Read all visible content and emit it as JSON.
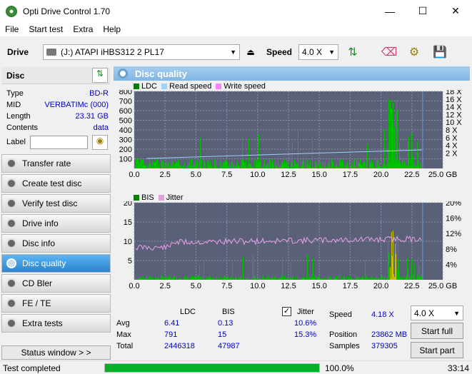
{
  "window": {
    "title": "Opti Drive Control 1.70"
  },
  "menu": [
    "File",
    "Start test",
    "Extra",
    "Help"
  ],
  "toolbar": {
    "drive_label": "Drive",
    "drive_value": "(J:)  ATAPI iHBS312  2 PL17",
    "speed_label": "Speed",
    "speed_value": "4.0 X"
  },
  "disc": {
    "header": "Disc",
    "type_label": "Type",
    "type": "BD-R",
    "mid_label": "MID",
    "mid": "VERBATIMc (000)",
    "length_label": "Length",
    "length": "23.31 GB",
    "contents_label": "Contents",
    "contents": "data",
    "label_label": "Label",
    "label_value": ""
  },
  "nav": [
    "Transfer rate",
    "Create test disc",
    "Verify test disc",
    "Drive info",
    "Disc info",
    "Disc quality",
    "CD Bler",
    "FE / TE",
    "Extra tests"
  ],
  "status_window_label": "Status window > >",
  "panel": {
    "title": "Disc quality"
  },
  "chart_data": [
    {
      "type": "bar",
      "title": "LDC / Read speed",
      "legend": [
        "LDC",
        "Read speed",
        "Write speed"
      ],
      "x_ticks": [
        "0.0",
        "2.5",
        "5.0",
        "7.5",
        "10.0",
        "12.5",
        "15.0",
        "17.5",
        "20.0",
        "22.5",
        "25.0 GB"
      ],
      "y_ticks_left": [
        "800",
        "700",
        "600",
        "500",
        "400",
        "300",
        "200",
        "100"
      ],
      "y_ticks_right": [
        "18 X",
        "16 X",
        "14 X",
        "12 X",
        "10 X",
        "8 X",
        "6 X",
        "4 X",
        "2 X"
      ],
      "xlim": [
        0,
        25
      ],
      "ylim": [
        0,
        800
      ],
      "read_speed_range_x": [
        1.0,
        4.18
      ]
    },
    {
      "type": "bar",
      "title": "BIS / Jitter",
      "legend": [
        "BIS",
        "Jitter"
      ],
      "x_ticks": [
        "0.0",
        "2.5",
        "5.0",
        "7.5",
        "10.0",
        "12.5",
        "15.0",
        "17.5",
        "20.0",
        "22.5",
        "25.0 GB"
      ],
      "y_ticks_left": [
        "20",
        "15",
        "10",
        "5"
      ],
      "y_ticks_right": [
        "20%",
        "16%",
        "12%",
        "8%",
        "4%"
      ],
      "xlim": [
        0,
        25
      ],
      "ylim": [
        0,
        20
      ]
    }
  ],
  "stats": {
    "col_ldc": "LDC",
    "col_bis": "BIS",
    "jitter_label": "Jitter",
    "jitter_checked": true,
    "rows": [
      {
        "label": "Avg",
        "ldc": "6.41",
        "bis": "0.13",
        "jitter": "10.6%"
      },
      {
        "label": "Max",
        "ldc": "791",
        "bis": "15",
        "jitter": "15.3%"
      },
      {
        "label": "Total",
        "ldc": "2446318",
        "bis": "47987",
        "jitter": ""
      }
    ],
    "speed_label": "Speed",
    "speed": "4.18 X",
    "position_label": "Position",
    "position": "23862 MB",
    "samples_label": "Samples",
    "samples": "379305",
    "speed_select": "4.0 X",
    "start_full": "Start full",
    "start_part": "Start part"
  },
  "statusbar": {
    "text": "Test completed",
    "progress": 100.0,
    "progress_label": "100.0%",
    "time": "33:14"
  }
}
